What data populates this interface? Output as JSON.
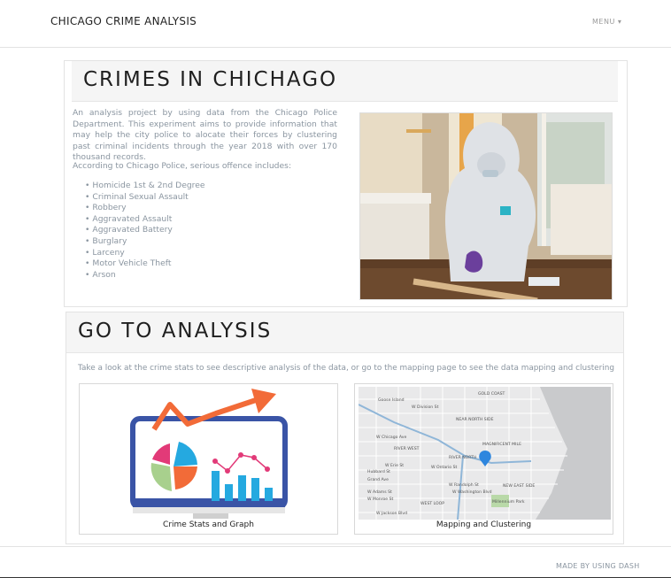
{
  "header": {
    "brand": "CHICAGO CRIME ANALYSIS",
    "menu_label": "MENU ▾"
  },
  "intro_section": {
    "title": "CRIMES IN CHICHAGO",
    "paragraph": "An analysis project by using data from the Chicago Police Department. This experiment aims to provide information that may help the city police to alocate their forces by clustering past criminal incidents through the year 2018 with over 170 thousand records.",
    "offence_intro": "According to Chicago Police, serious offence includes:",
    "offences": [
      "Homicide 1st & 2nd Degree",
      "Criminal Sexual Assault",
      "Robbery",
      "Aggravated Assault",
      "Aggravated Battery",
      "Burglary",
      "Larceny",
      "Motor Vehicle Theft",
      "Arson"
    ]
  },
  "analysis_section": {
    "title": "GO TO ANALYSIS",
    "description": "Take a look at the crime stats to see descriptive analysis of the data, or go to the mapping page to see the data mapping and clustering",
    "tiles": [
      {
        "label": "Crime Stats and Graph"
      },
      {
        "label": "Mapping and Clustering"
      }
    ]
  },
  "map_labels": [
    "Goose Island",
    "GOLD COAST",
    "NEAR NORTH SIDE",
    "MAGNIFICENT MILE",
    "RIVER NORTH",
    "RIVER WEST",
    "WEST LOOP",
    "NEW EAST SIDE",
    "Millennium Park",
    "Hubbard St",
    "Grand Ave",
    "W Ontario St",
    "W Erie St",
    "W Chicago Ave",
    "W Randolph St",
    "W Washington Blvd",
    "W Adams St",
    "W Monroe St",
    "W Jackson Blvd",
    "W Division St"
  ],
  "colors": {
    "accent_orange": "#f26b38",
    "monitor_blue": "#3a54a6",
    "pin_blue": "#2e86de"
  },
  "footer": {
    "text": "MADE BY USING DASH"
  }
}
